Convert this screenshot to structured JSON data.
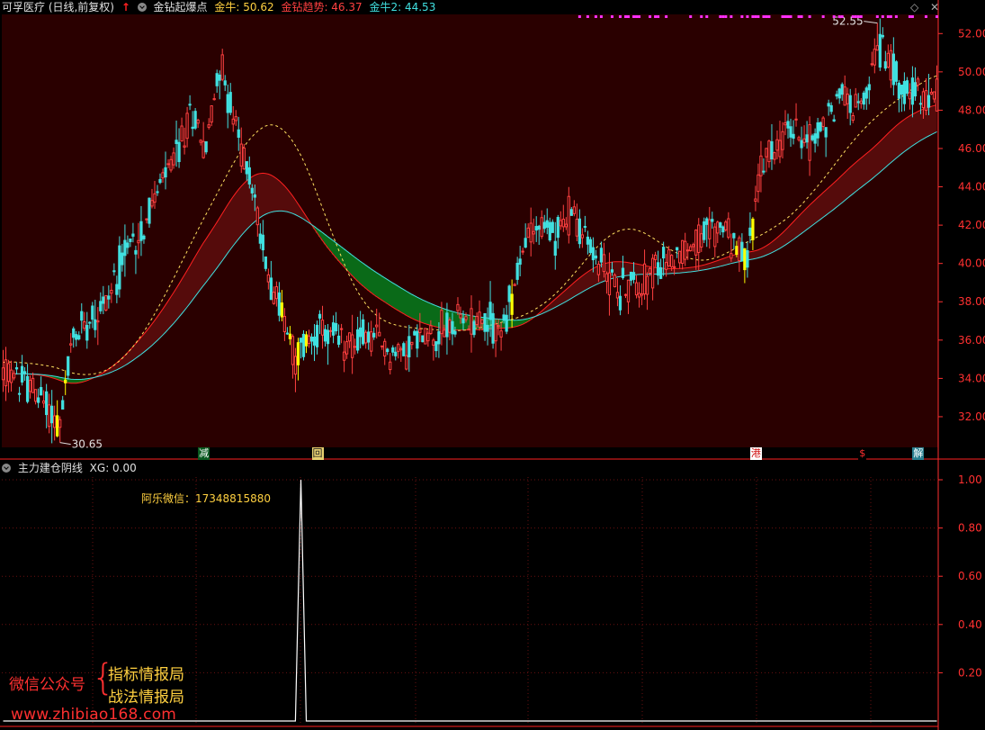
{
  "header": {
    "stock": "可孚医疗 (日线,前复权)",
    "indicator_name": "金钻起爆点",
    "items": [
      {
        "label": "金牛: 50.62",
        "color": "#ffd040"
      },
      {
        "label": "金钻趋势: 46.37",
        "color": "#ff4040"
      },
      {
        "label": "金牛2: 44.53",
        "color": "#40e0e0"
      }
    ]
  },
  "sub_header": {
    "indicator_name": "主力建仓阴线",
    "value_label": "XG: 0.00"
  },
  "contact": "阿乐微信：17348815880",
  "watermark": {
    "left": "微信公众号",
    "right_line1": "指标情报局",
    "right_line2": "战法情报局",
    "url": "www.zhibiao168.com"
  },
  "markers": [
    {
      "text": "减",
      "bg": "#0a5a20",
      "fg": "#ffffff",
      "day": 74
    },
    {
      "text": "回",
      "bg": "#e8d070",
      "fg": "#202020",
      "day": 116
    },
    {
      "text": "港",
      "bg": "#ffffff",
      "fg": "#d01010",
      "day": 278
    },
    {
      "text": "$",
      "bg": "#000000",
      "fg": "#ff3030",
      "day": 318
    },
    {
      "text": "解",
      "bg": "#2a8090",
      "fg": "#ffffff",
      "day": 338
    }
  ],
  "icons": {
    "diamond": "◇",
    "close": "✕"
  },
  "colors": {
    "up": "#ff4040",
    "down": "#40e0e0",
    "signal": "#ffff00",
    "price_axis": "#ff3030",
    "bg_main": "#2a0000",
    "band": "#5a0c0c",
    "green_band": "#0a6a18"
  },
  "chart_data": [
    {
      "type": "candlestick",
      "title": "可孚医疗 (日线,前复权)",
      "y_ticks": [
        32,
        34,
        36,
        38,
        40,
        42,
        44,
        46,
        48,
        50,
        52
      ],
      "ylim": [
        30.4,
        53.0
      ],
      "annotations": [
        {
          "text": "52.55",
          "day": 323,
          "value": 52.55
        },
        {
          "text": "30.65",
          "day": 21,
          "value": 30.65
        }
      ],
      "key_prices": {
        "low": 30.65,
        "high": 52.55
      },
      "series_shape": [
        [
          0,
          34.3
        ],
        [
          8,
          33.8
        ],
        [
          15,
          32.8
        ],
        [
          21,
          31.5
        ],
        [
          25,
          35.5
        ],
        [
          30,
          37.0
        ],
        [
          38,
          38.0
        ],
        [
          45,
          40.5
        ],
        [
          52,
          42.0
        ],
        [
          58,
          44.0
        ],
        [
          65,
          46.0
        ],
        [
          70,
          48.0
        ],
        [
          75,
          46.0
        ],
        [
          80,
          50.5
        ],
        [
          86,
          47.0
        ],
        [
          92,
          44.0
        ],
        [
          97,
          40.0
        ],
        [
          103,
          37.5
        ],
        [
          108,
          35.0
        ],
        [
          115,
          36.5
        ],
        [
          125,
          35.8
        ],
        [
          135,
          36.2
        ],
        [
          145,
          35.2
        ],
        [
          155,
          36.2
        ],
        [
          165,
          36.7
        ],
        [
          175,
          37.2
        ],
        [
          185,
          36.5
        ],
        [
          190,
          39.5
        ],
        [
          195,
          42.0
        ],
        [
          205,
          41.5
        ],
        [
          210,
          42.8
        ],
        [
          218,
          40.5
        ],
        [
          228,
          38.6
        ],
        [
          235,
          39.0
        ],
        [
          245,
          40.0
        ],
        [
          255,
          41.0
        ],
        [
          265,
          42.0
        ],
        [
          275,
          40.0
        ],
        [
          280,
          45.0
        ],
        [
          290,
          47.0
        ],
        [
          300,
          46.5
        ],
        [
          310,
          49.0
        ],
        [
          318,
          48.0
        ],
        [
          323,
          51.5
        ],
        [
          330,
          50.0
        ],
        [
          338,
          48.5
        ],
        [
          345,
          48.8
        ]
      ],
      "yellow_signal_days": [
        103,
        106,
        109,
        112,
        188,
        271,
        274,
        277,
        20,
        23
      ]
    },
    {
      "type": "line",
      "title": "主力建仓阴线",
      "y_ticks": [
        0.2,
        0.4,
        0.6,
        0.8,
        1.0
      ],
      "ylim": [
        0,
        1.0
      ],
      "spike_day": 110,
      "values_description_day_value": [
        [
          0,
          0
        ],
        [
          108,
          0
        ],
        [
          110,
          1.0
        ],
        [
          112,
          0
        ],
        [
          345,
          0
        ]
      ]
    }
  ]
}
